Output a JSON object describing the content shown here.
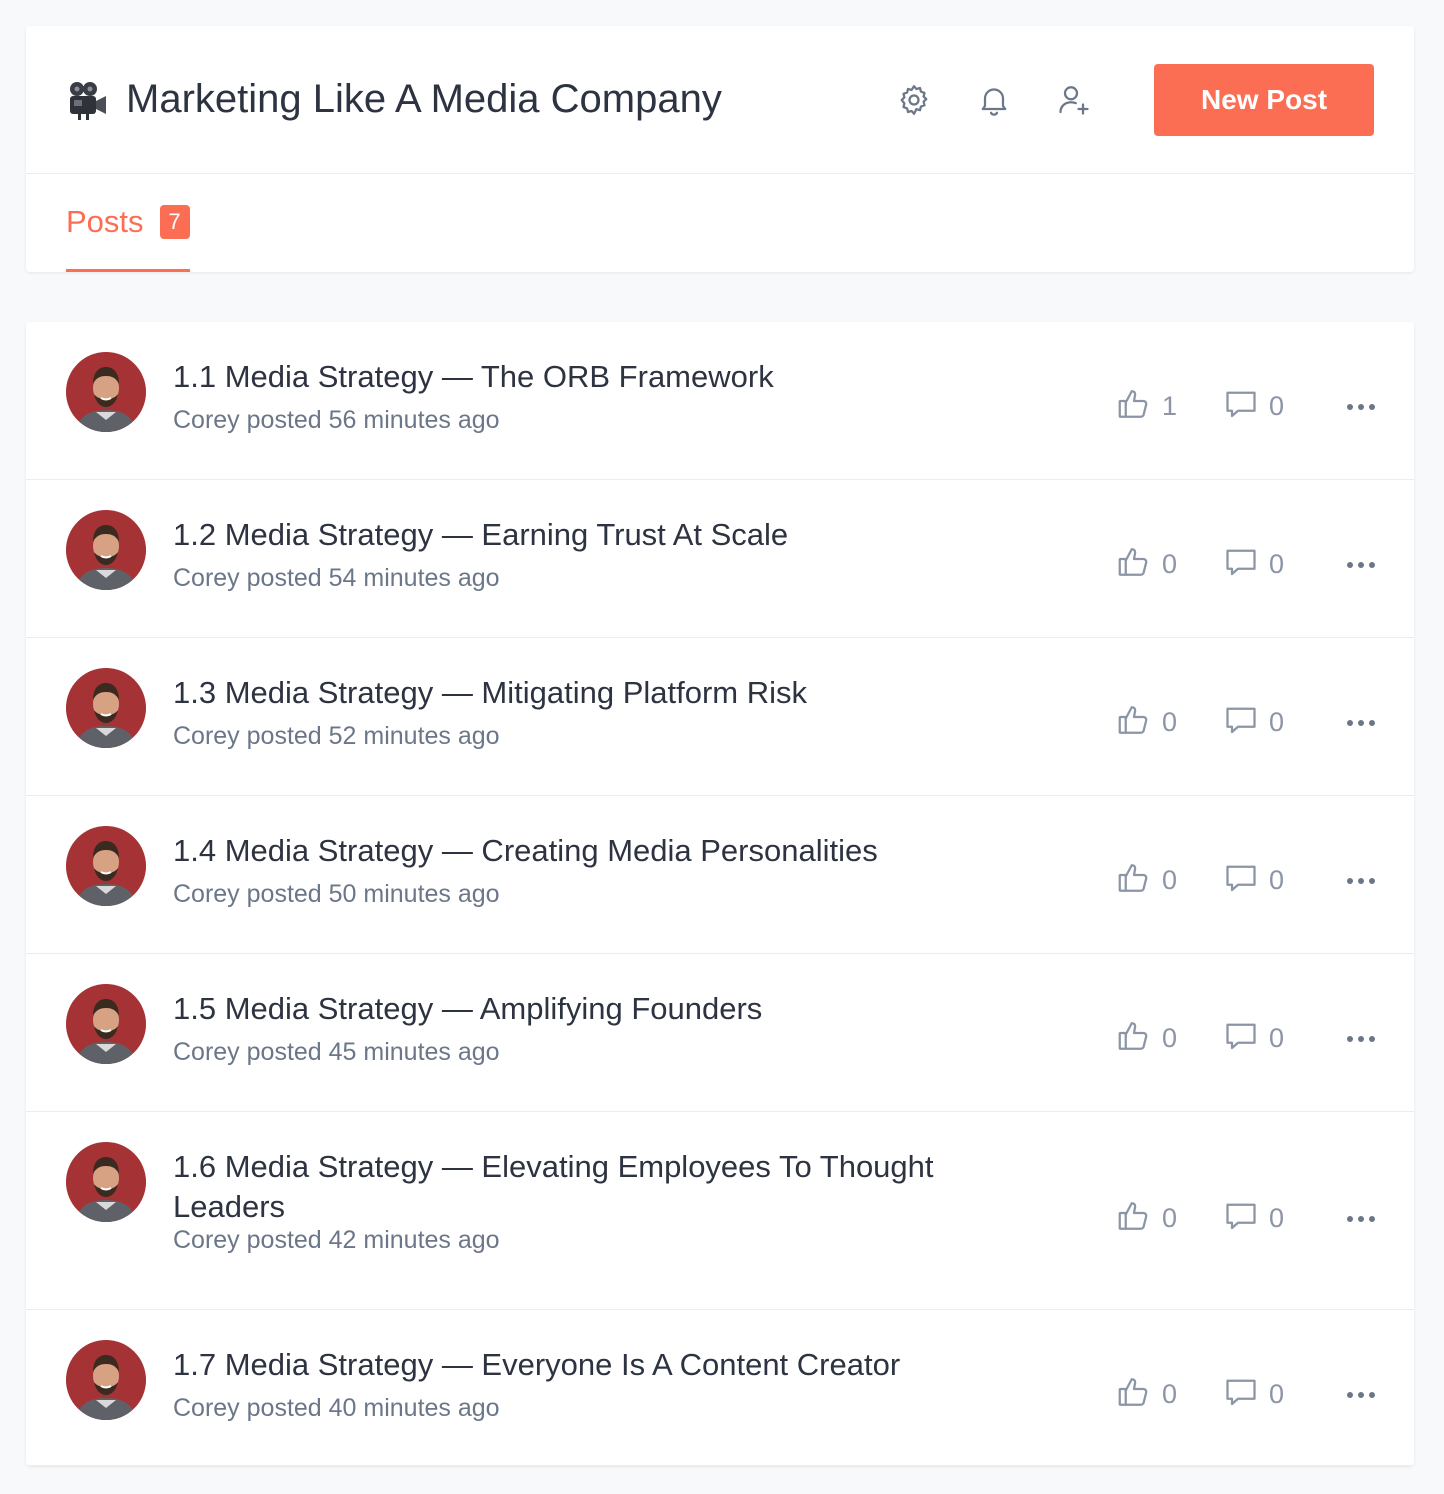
{
  "header": {
    "title": "Marketing Like A Media Company",
    "space_icon": "movie-camera-icon",
    "icons": [
      "gear-icon",
      "bell-icon",
      "add-user-icon"
    ],
    "new_post_label": "New Post"
  },
  "tabs": [
    {
      "label": "Posts",
      "count": "7",
      "active": true
    }
  ],
  "posts": [
    {
      "title": "1.1 Media Strategy — The ORB Framework",
      "meta": "Corey posted 56 minutes ago",
      "likes": "1",
      "comments": "0"
    },
    {
      "title": "1.2 Media Strategy — Earning Trust At Scale",
      "meta": "Corey posted 54 minutes ago",
      "likes": "0",
      "comments": "0"
    },
    {
      "title": "1.3 Media Strategy — Mitigating Platform Risk",
      "meta": "Corey posted 52 minutes ago",
      "likes": "0",
      "comments": "0"
    },
    {
      "title": "1.4 Media Strategy — Creating Media Personalities",
      "meta": "Corey posted 50 minutes ago",
      "likes": "0",
      "comments": "0"
    },
    {
      "title": "1.5 Media Strategy — Amplifying Founders",
      "meta": "Corey posted 45 minutes ago",
      "likes": "0",
      "comments": "0"
    },
    {
      "title": "1.6 Media Strategy — Elevating Employees To Thought Leaders",
      "meta": "Corey posted 42 minutes ago",
      "likes": "0",
      "comments": "0"
    },
    {
      "title": "1.7 Media Strategy — Everyone Is A Content Creator",
      "meta": "Corey posted 40 minutes ago",
      "likes": "0",
      "comments": "0"
    }
  ],
  "colors": {
    "accent": "#fc6e54",
    "title_text": "#2d3340",
    "meta_text": "#6b7789",
    "icon_gray": "#8b95a5"
  }
}
